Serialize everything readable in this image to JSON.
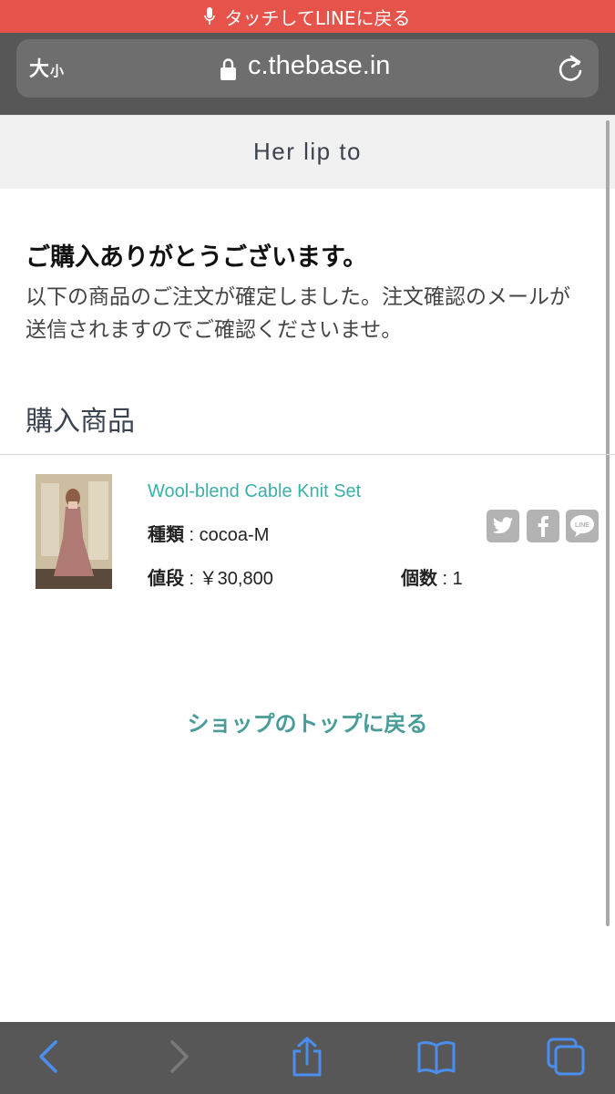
{
  "banner": {
    "text": "タッチしてLINEに戻る"
  },
  "browser": {
    "text_size_large": "大",
    "text_size_small": "小",
    "url": "c.thebase.in"
  },
  "shop": {
    "name": "Her lip to"
  },
  "confirmation": {
    "heading": "ご購入ありがとうございます。",
    "message": "以下の商品のご注文が確定しました。注文確認のメールが送信されますのでご確認くださいませ。"
  },
  "purchased": {
    "section_title": "購入商品",
    "item": {
      "name": "Wool-blend Cable Knit Set",
      "variant_label": "種類",
      "variant_value": " : cocoa-M",
      "price_label": "値段",
      "price_value": " : ￥30,800",
      "qty_label": "個数",
      "qty_value": " : 1"
    }
  },
  "share_icons": [
    "twitter-icon",
    "facebook-icon",
    "line-icon"
  ],
  "back_link": "ショップのトップに戻る",
  "colors": {
    "banner": "#e5534a",
    "accent": "#3bb0a7",
    "link": "#4a9c99",
    "toolbar_icon": "#4a8ff0"
  }
}
